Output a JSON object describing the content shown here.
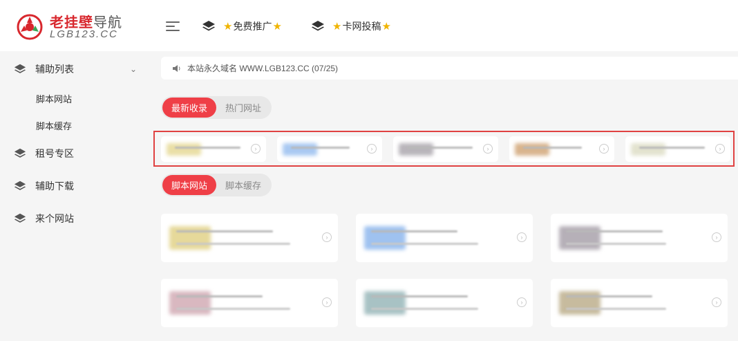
{
  "logo": {
    "title_red": "老挂壁",
    "title_gray": "导航",
    "subtitle": "LGB123.CC"
  },
  "header": {
    "nav": [
      {
        "label": "免费推广",
        "icon": "layers-icon"
      },
      {
        "label": "卡网投稿",
        "icon": "layers-icon"
      }
    ],
    "star": "★"
  },
  "sidebar": {
    "items": [
      {
        "label": "辅助列表",
        "icon": "layers-icon",
        "expanded": true,
        "children": [
          "脚本网站",
          "脚本缓存"
        ]
      },
      {
        "label": "租号专区",
        "icon": "layers-icon"
      },
      {
        "label": "辅助下载",
        "icon": "layers-icon"
      },
      {
        "label": "来个网站",
        "icon": "layers-icon"
      }
    ]
  },
  "notice": {
    "icon": "speaker-icon",
    "text": "本站永久域名 WWW.LGB123.CC (07/25)"
  },
  "section1": {
    "tabs": [
      "最新收录",
      "热门网址"
    ],
    "active": 0
  },
  "section2": {
    "tabs": [
      "脚本网站",
      "脚本缓存"
    ],
    "active": 0
  },
  "colors": {
    "accent": "#ef3f47",
    "highlight_border": "#e04141",
    "logo_red": "#d8272d",
    "star": "#f0b400"
  },
  "small_cards": [
    {
      "thumb_color": "#eadfa6"
    },
    {
      "thumb_color": "#a9c9f2"
    },
    {
      "thumb_color": "#b9b5bb"
    },
    {
      "thumb_color": "#d9b48d"
    },
    {
      "thumb_color": "#e3e3cf"
    }
  ],
  "big_cards": [
    {
      "thumb_color": "#e6d99a"
    },
    {
      "thumb_color": "#9fc2f0"
    },
    {
      "thumb_color": "#b6b0b8"
    },
    {
      "thumb_color": "#d9b8c0"
    },
    {
      "thumb_color": "#a8c2c4"
    },
    {
      "thumb_color": "#c7bb9e"
    }
  ]
}
